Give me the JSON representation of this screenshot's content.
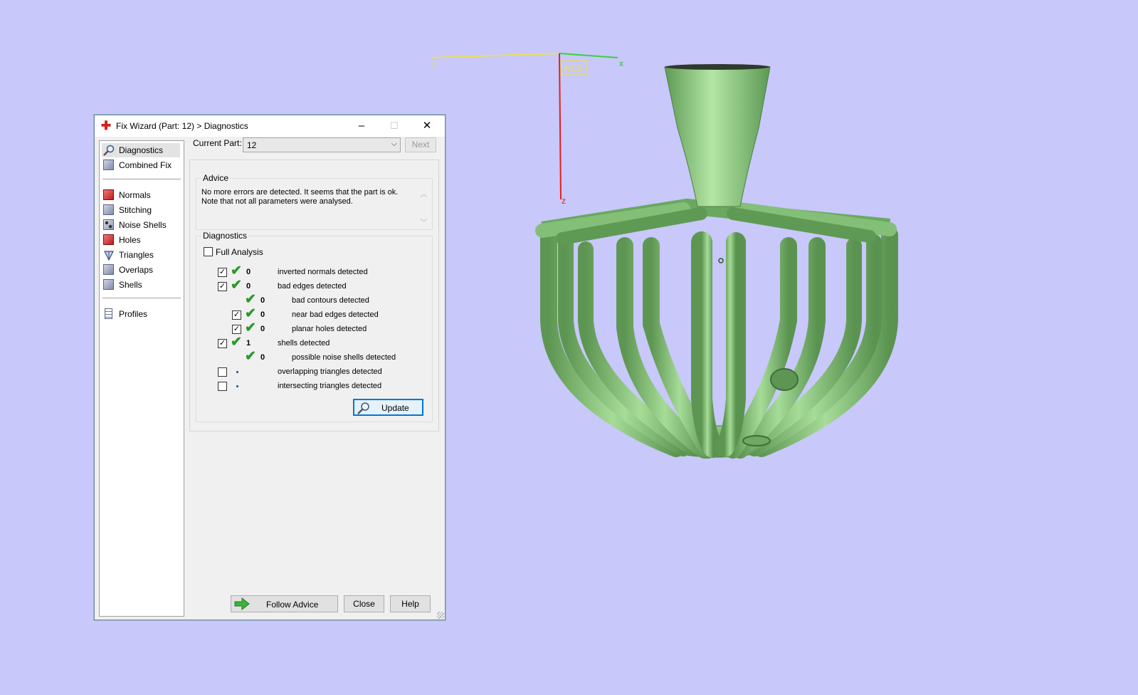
{
  "window": {
    "title": "Fix Wizard (Part: 12) > Diagnostics",
    "minimize": "–",
    "maximize": "☐",
    "close": "✕"
  },
  "nav": {
    "items": [
      {
        "label": "Diagnostics",
        "icon": "magnifier-icon"
      },
      {
        "label": "Combined Fix",
        "icon": "combined-fix-icon"
      },
      {
        "label": "Normals",
        "icon": "normals-icon"
      },
      {
        "label": "Stitching",
        "icon": "stitching-icon"
      },
      {
        "label": "Noise Shells",
        "icon": "noise-shells-icon"
      },
      {
        "label": "Holes",
        "icon": "holes-icon"
      },
      {
        "label": "Triangles",
        "icon": "triangles-icon"
      },
      {
        "label": "Overlaps",
        "icon": "overlaps-icon"
      },
      {
        "label": "Shells",
        "icon": "shells-icon"
      },
      {
        "label": "Profiles",
        "icon": "profiles-icon"
      }
    ],
    "selected": "Diagnostics"
  },
  "current_part": {
    "label": "Current Part:",
    "value": "12",
    "next_label": "Next"
  },
  "advice": {
    "title": "Advice",
    "text": "No more errors are detected. It seems that the part is ok. Note that not all parameters were analysed."
  },
  "diagnostics": {
    "title": "Diagnostics",
    "full_analysis_label": "Full Analysis",
    "full_analysis_checked": false,
    "rows": [
      {
        "checked": true,
        "status": "ok",
        "count": "0",
        "text": "inverted normals detected"
      },
      {
        "checked": true,
        "status": "ok",
        "count": "0",
        "text": "bad edges detected"
      },
      {
        "checked": null,
        "status": "ok",
        "count": "0",
        "text": "bad contours detected"
      },
      {
        "checked": true,
        "status": "ok",
        "count": "0",
        "text": "near bad edges detected"
      },
      {
        "checked": true,
        "status": "ok",
        "count": "0",
        "text": "planar holes detected"
      },
      {
        "checked": true,
        "status": "ok",
        "count": "1",
        "text": "shells detected"
      },
      {
        "checked": null,
        "status": "ok",
        "count": "0",
        "text": "possible noise shells detected"
      },
      {
        "checked": false,
        "status": "unknown",
        "count": "",
        "text": "overlapping triangles detected"
      },
      {
        "checked": false,
        "status": "unknown",
        "count": "",
        "text": "intersecting triangles detected"
      }
    ],
    "update_label": "Update"
  },
  "footer": {
    "follow_advice": "Follow Advice",
    "close": "Close",
    "help": "Help"
  },
  "viewport": {
    "axis_y": "y",
    "axis_x": "x",
    "axis_z": "z",
    "wcs": "WCS",
    "background": "#c8c8fa",
    "model_color": "#7fbf6f"
  }
}
